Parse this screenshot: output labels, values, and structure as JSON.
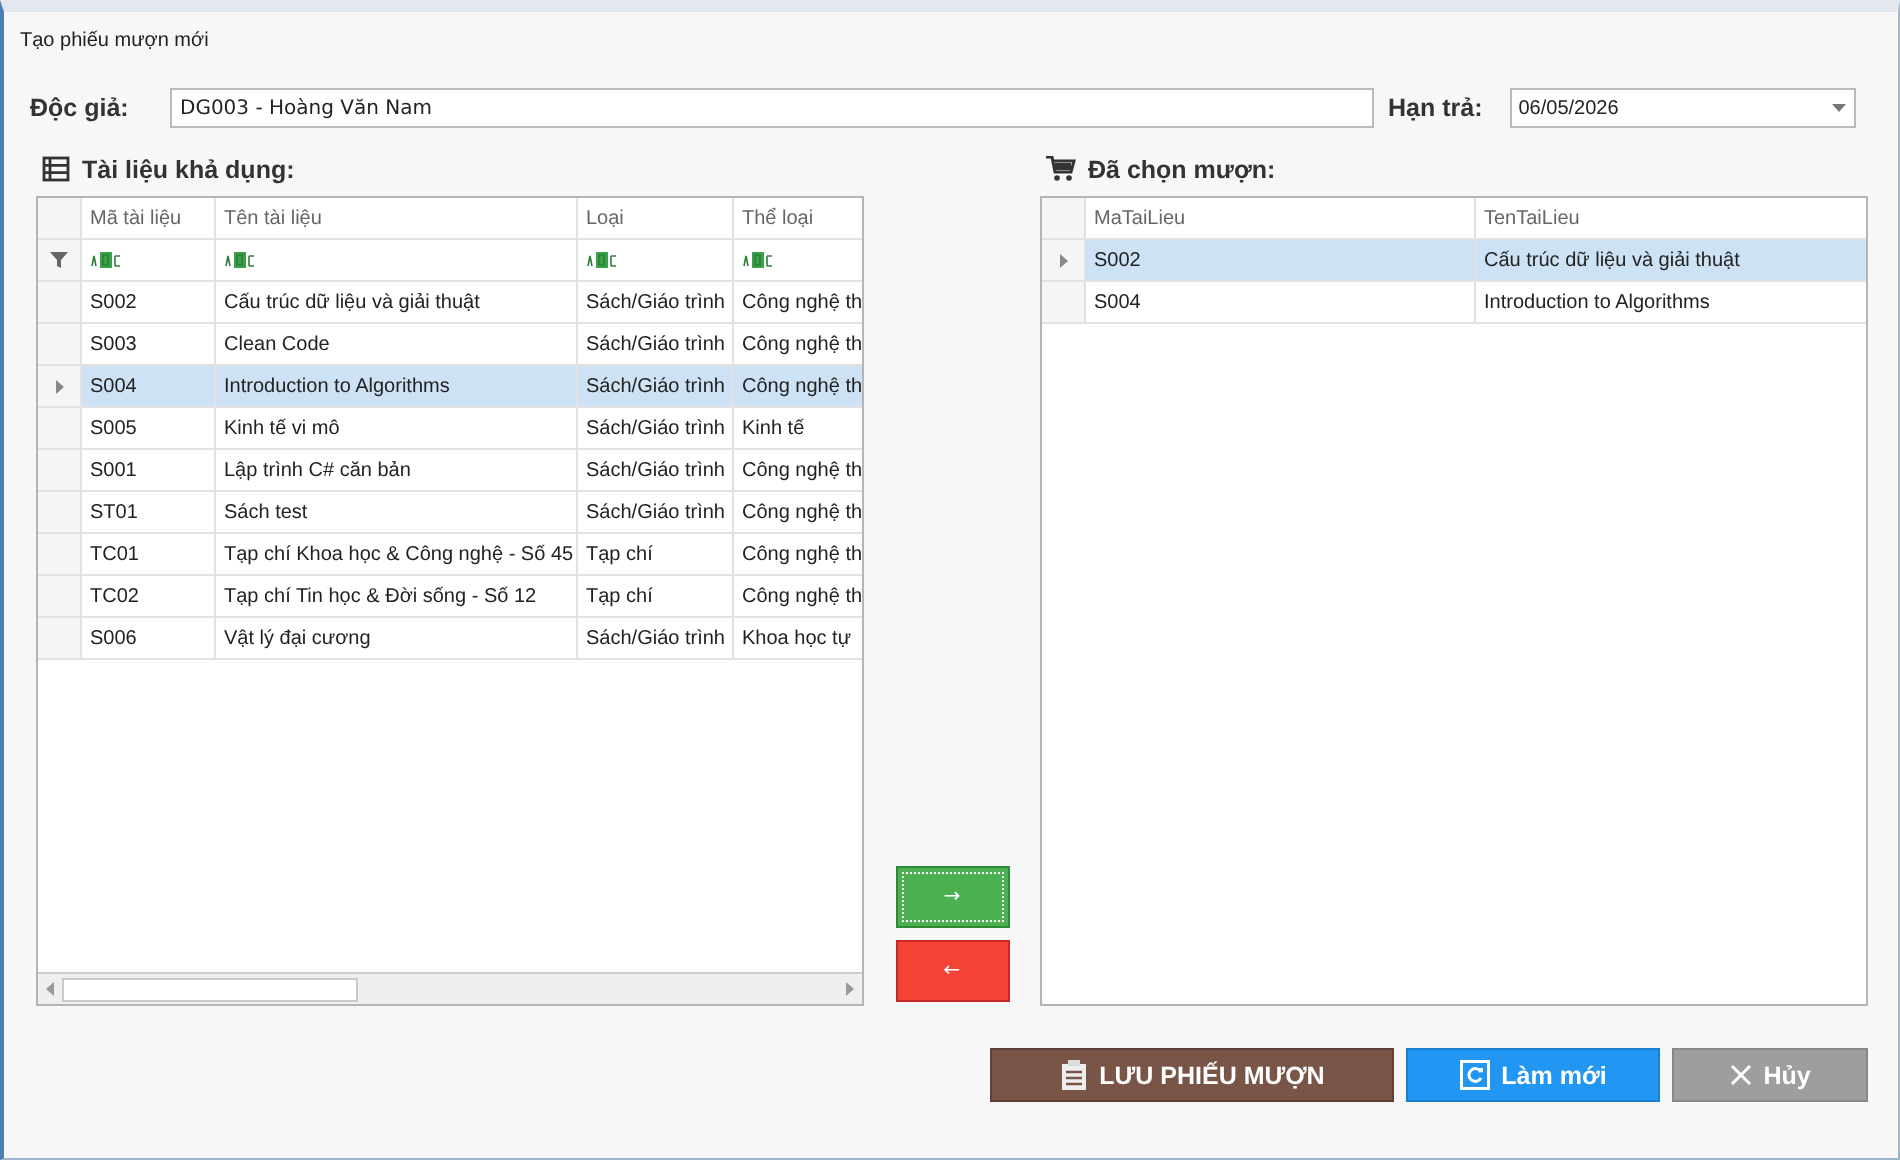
{
  "window": {
    "title": "Tạo phiếu mượn mới"
  },
  "reader": {
    "label": "Độc giả:",
    "value": "DG003 - Hoàng Văn Nam"
  },
  "due_date": {
    "label": "Hạn trả:",
    "value": "06/05/2026"
  },
  "available": {
    "title": "Tài liệu khả dụng:",
    "columns": [
      "Mã tài liệu",
      "Tên tài liệu",
      "Loại",
      "Thể loại"
    ],
    "rows": [
      {
        "cells": [
          "S002",
          "Cấu trúc dữ liệu và giải thuật",
          "Sách/Giáo trình",
          "Công nghệ th"
        ],
        "selected": false
      },
      {
        "cells": [
          "S003",
          "Clean Code",
          "Sách/Giáo trình",
          "Công nghệ th"
        ],
        "selected": false
      },
      {
        "cells": [
          "S004",
          "Introduction to Algorithms",
          "Sách/Giáo trình",
          "Công nghệ th"
        ],
        "selected": true
      },
      {
        "cells": [
          "S005",
          "Kinh tế vi mô",
          "Sách/Giáo trình",
          "Kinh tế"
        ],
        "selected": false
      },
      {
        "cells": [
          "S001",
          "Lập trình C# căn bản",
          "Sách/Giáo trình",
          "Công nghệ th"
        ],
        "selected": false
      },
      {
        "cells": [
          "ST01",
          "Sách test",
          "Sách/Giáo trình",
          "Công nghệ th"
        ],
        "selected": false
      },
      {
        "cells": [
          "TC01",
          "Tạp chí Khoa học & Công nghệ - Số 45",
          "Tạp chí",
          "Công nghệ th"
        ],
        "selected": false
      },
      {
        "cells": [
          "TC02",
          "Tạp chí Tin học & Đời sống - Số 12",
          "Tạp chí",
          "Công nghệ th"
        ],
        "selected": false
      },
      {
        "cells": [
          "S006",
          "Vật lý đại cương",
          "Sách/Giáo trình",
          "Khoa học tự"
        ],
        "selected": false
      }
    ]
  },
  "chosen": {
    "title": "Đã chọn mượn:",
    "columns": [
      "MaTaiLieu",
      "TenTaiLieu"
    ],
    "rows": [
      {
        "cells": [
          "S002",
          "Cấu trúc dữ liệu và giải thuật"
        ],
        "selected": true
      },
      {
        "cells": [
          "S004",
          "Introduction to Algorithms"
        ],
        "selected": false
      }
    ]
  },
  "move_buttons": [
    {
      "label": "→",
      "kind": "add"
    },
    {
      "label": "←",
      "kind": "remove"
    }
  ],
  "buttons": [
    {
      "label": "LƯU PHIẾU MƯỢN",
      "kind": "save"
    },
    {
      "label": "Làm mới",
      "kind": "refresh"
    },
    {
      "label": "Hủy",
      "kind": "cancel"
    }
  ]
}
